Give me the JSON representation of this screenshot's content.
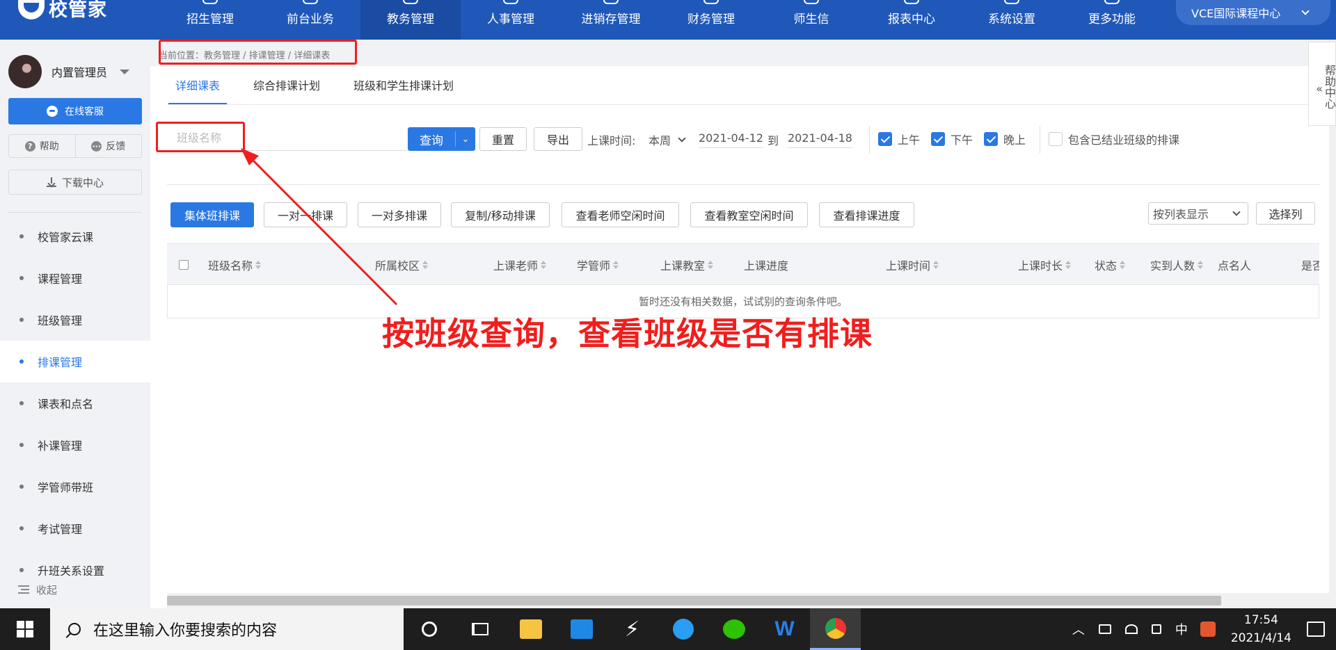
{
  "app": {
    "logo_text": "校管家",
    "nav": [
      "招生管理",
      "前台业务",
      "教务管理",
      "人事管理",
      "进销存管理",
      "财务管理",
      "师生信",
      "报表中心",
      "系统设置",
      "更多功能"
    ],
    "active_nav": 2,
    "org_name": "VCE国际课程中心",
    "accent": "#1f58b8"
  },
  "sidebar": {
    "user_name": "内置管理员",
    "service_button": "在线客服",
    "help": "帮助",
    "feedback": "反馈",
    "download_center": "下载中心",
    "menu": [
      {
        "label": "校管家云课"
      },
      {
        "label": "课程管理"
      },
      {
        "label": "班级管理"
      },
      {
        "label": "排课管理"
      },
      {
        "label": "课表和点名"
      },
      {
        "label": "补课管理"
      },
      {
        "label": "学管师带班"
      },
      {
        "label": "考试管理"
      },
      {
        "label": "升班关系设置"
      }
    ],
    "active_index": 3,
    "collapse": "收起"
  },
  "main": {
    "breadcrumb": "当前位置：教务管理 / 排课管理 / 详细课表",
    "tabs": [
      "详细课表",
      "综合排课计划",
      "班级和学生排课计划"
    ],
    "active_tab": 0,
    "filters": {
      "class_name_placeholder": "班级名称",
      "query": "查询",
      "reset": "重置",
      "export": "导出",
      "time_label": "上课时间:",
      "week": "本周",
      "date_from": "2021-04-12",
      "to": "到",
      "date_to": "2021-04-18",
      "morning": "上午",
      "afternoon": "下午",
      "evening": "晚上",
      "include_closed": "包含已结业班级的排课",
      "morning_checked": true,
      "afternoon_checked": true,
      "evening_checked": true,
      "include_closed_checked": false
    },
    "actions": [
      "集体班排课",
      "一对一排课",
      "一对多排课",
      "复制/移动排课",
      "查看老师空闲时间",
      "查看教室空闲时间",
      "查看排课进度"
    ],
    "view_mode": "按列表显示",
    "select_columns": "选择列",
    "columns": [
      "班级名称",
      "所属校区",
      "上课老师",
      "学管师",
      "上课教室",
      "上课进度",
      "上课时间",
      "上课时长",
      "状态",
      "实到人数",
      "点名人",
      "是否为"
    ],
    "empty_text": "暂时还没有相关数据，试试别的查询条件吧。"
  },
  "help_panel": "帮助中心",
  "annotation": "按班级查询，查看班级是否有排课",
  "taskbar": {
    "search_placeholder": "在这里输入你要搜索的内容",
    "ime": "中",
    "time": "17:54",
    "date": "2021/4/14"
  }
}
